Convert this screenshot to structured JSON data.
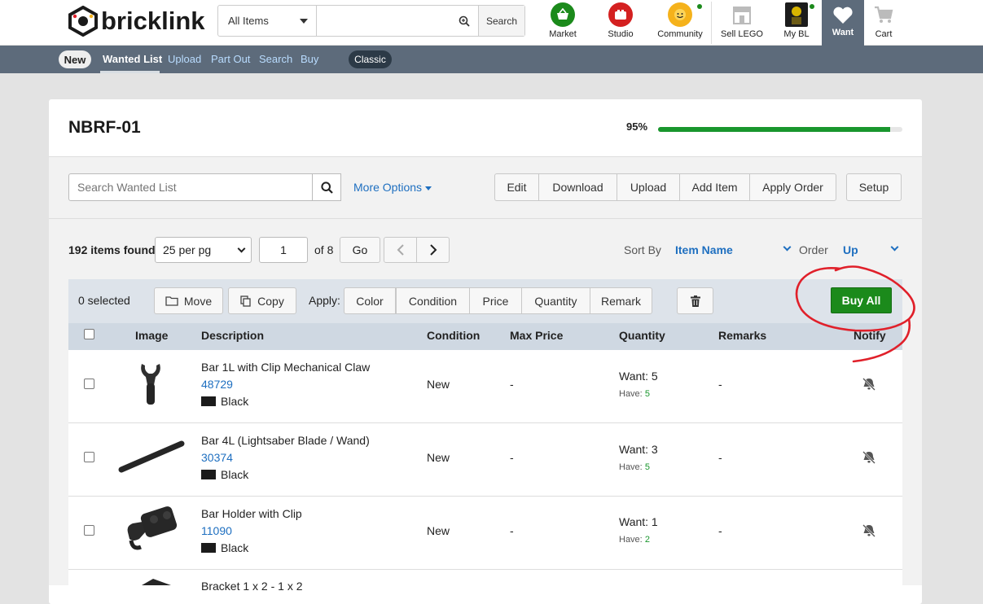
{
  "topnav": {
    "logo_text": "bricklink",
    "search_category": "All Items",
    "search_button": "Search",
    "search_placeholder": "",
    "icons": [
      {
        "label": "Market",
        "icon": "basket-icon",
        "color": "#1b8a1b"
      },
      {
        "label": "Studio",
        "icon": "studio-icon",
        "color": "#d42020"
      },
      {
        "label": "Community",
        "icon": "minifig-face-icon",
        "color": "#f5b21b"
      },
      {
        "label": "Sell LEGO",
        "icon": "store-icon",
        "color": "#bbbbbb"
      },
      {
        "label": "My BL",
        "icon": "avatar-icon",
        "color": "#333333"
      },
      {
        "label": "Want",
        "icon": "heart-icon",
        "color": "#ffffff"
      },
      {
        "label": "Cart",
        "icon": "cart-icon",
        "color": "#bbbbbb"
      }
    ]
  },
  "subnav": {
    "new_label": "New",
    "links": [
      "Wanted List",
      "Upload",
      "Part Out",
      "Search",
      "Buy"
    ],
    "classic_label": "Classic"
  },
  "list": {
    "title": "NBRF-01",
    "progress_label": "95%",
    "progress_value": 0.95
  },
  "toolbar": {
    "search_placeholder": "Search Wanted List",
    "more_options": "More Options",
    "buttons": [
      "Edit",
      "Download",
      "Upload",
      "Add Item",
      "Apply Order"
    ],
    "setup": "Setup"
  },
  "paging": {
    "found": "192 items found",
    "per_page": "25 per pg",
    "page": "1",
    "of_pages": "of 8",
    "go": "Go",
    "sort_by_label": "Sort By",
    "sort_by_value": "Item Name",
    "order_label": "Order",
    "order_value": "Up"
  },
  "actions": {
    "selected": "0 selected",
    "move": "Move",
    "copy": "Copy",
    "apply_label": "Apply:",
    "apply_buttons": [
      "Color",
      "Condition",
      "Price",
      "Quantity",
      "Remark"
    ],
    "buy_all": "Buy All"
  },
  "table": {
    "headers": [
      "Image",
      "Description",
      "Condition",
      "Max Price",
      "Quantity",
      "Remarks",
      "Notify"
    ],
    "rows": [
      {
        "name": "Bar 1L with Clip Mechanical Claw",
        "id": "48729",
        "color": "Black",
        "condition": "New",
        "max_price": "-",
        "want": "Want: 5",
        "have_label": "Have:",
        "have": "5",
        "remarks": "-",
        "notify_icon": "bell-off-icon"
      },
      {
        "name": "Bar 4L (Lightsaber Blade / Wand)",
        "id": "30374",
        "color": "Black",
        "condition": "New",
        "max_price": "-",
        "want": "Want: 3",
        "have_label": "Have:",
        "have": "5",
        "remarks": "-",
        "notify_icon": "bell-off-icon"
      },
      {
        "name": "Bar Holder with Clip",
        "id": "11090",
        "color": "Black",
        "condition": "New",
        "max_price": "-",
        "want": "Want: 1",
        "have_label": "Have:",
        "have": "2",
        "remarks": "-",
        "notify_icon": "bell-off-icon"
      }
    ],
    "partial_row_name": "Bracket 1 x 2 - 1 x 2"
  },
  "colors": {
    "accent_blue": "#1e6fc0",
    "success_green": "#1b8a1b",
    "nav_slate": "#5d6b7b",
    "annotation_red": "#e0202a"
  }
}
